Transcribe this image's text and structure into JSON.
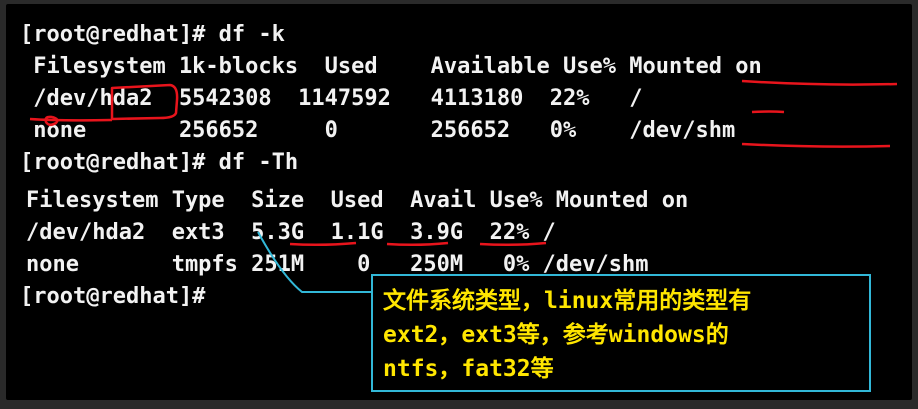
{
  "terminal": {
    "lines": [
      "[root@redhat]# df -k",
      " Filesystem 1k-blocks  Used    Available Use% Mounted on",
      " /dev/hda2  5542308  1147592   4113180  22%   /",
      " none       256652     0       256652   0%    /dev/shm",
      "[root@redhat]# df -Th",
      "Filesystem Type  Size  Used  Avail Use% Mounted on",
      "/dev/hda2  ext3  5.3G  1.1G  3.9G  22% /",
      "none       tmpfs 251M    0   250M   0% /dev/shm",
      "[root@redhat]#"
    ]
  },
  "note": {
    "line1": "文件系统类型，linux常用的类型有",
    "line2": "ext2，ext3等，参考windows的",
    "line3": "ntfs，fat32等"
  },
  "colors": {
    "background": "#000000",
    "text": "#f2f2f2",
    "note_text": "#ffe600",
    "note_border": "#32b8d8",
    "markup_red": "#e8141c"
  }
}
